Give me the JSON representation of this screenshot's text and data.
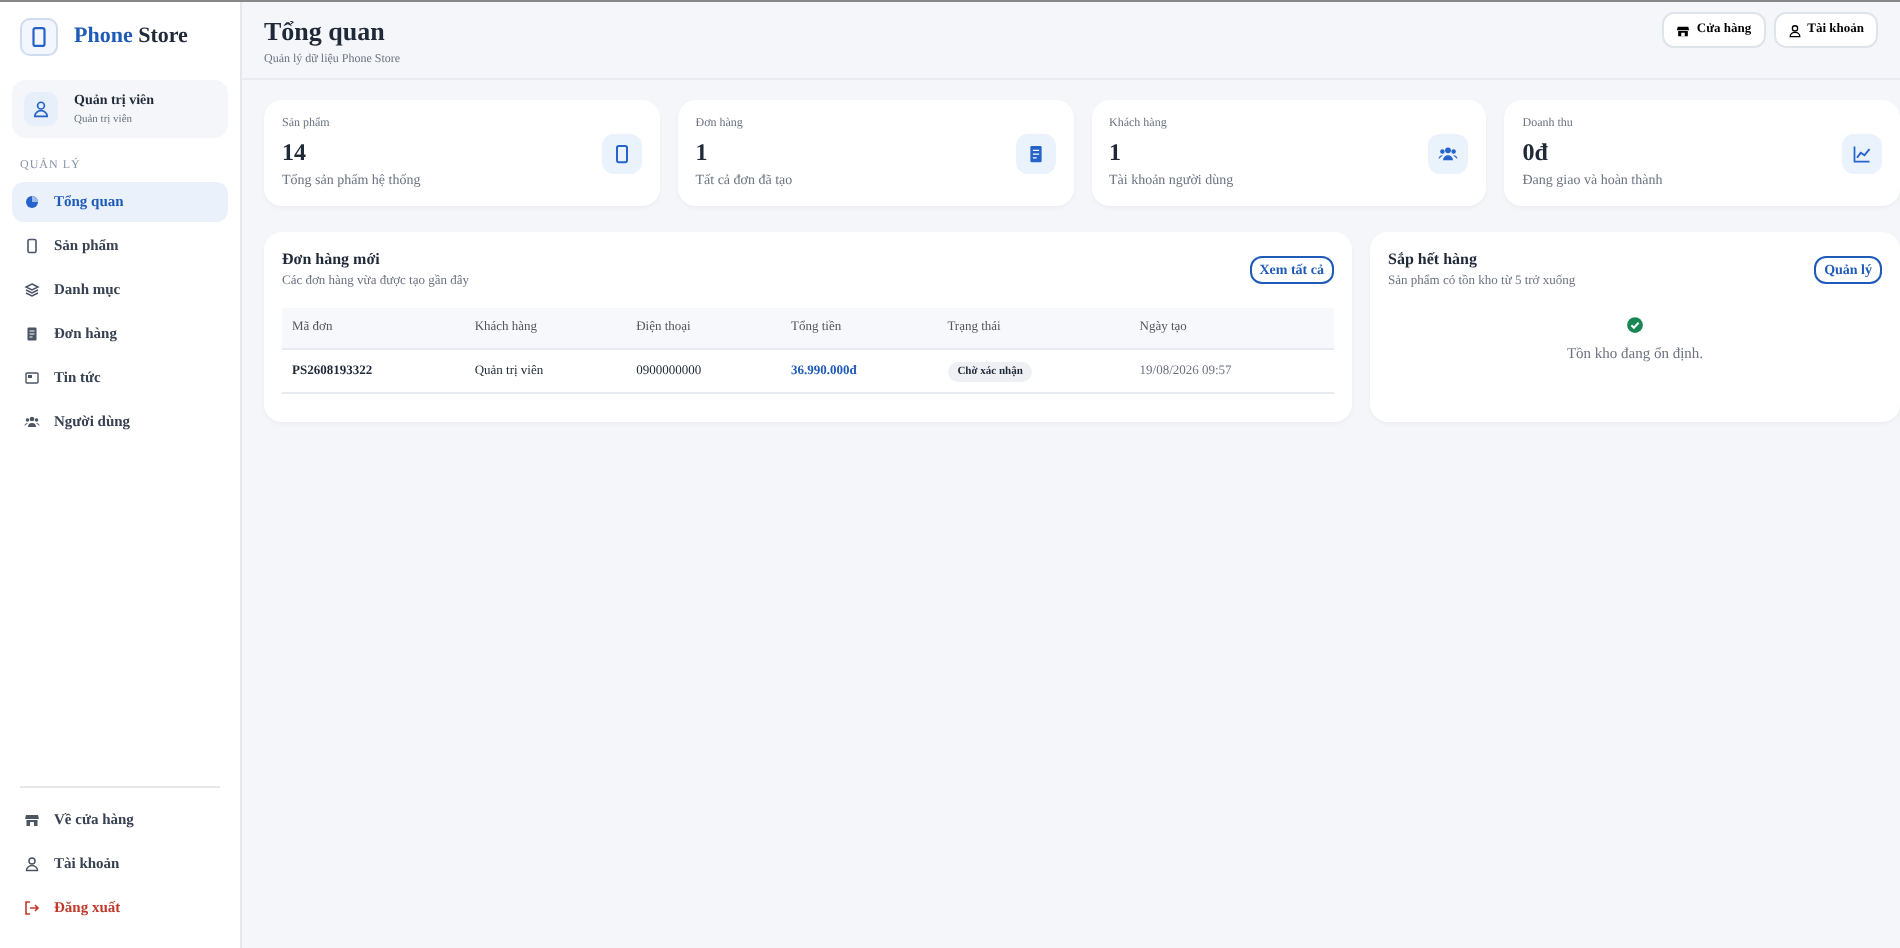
{
  "brand": {
    "first": "Phone",
    "second": "Store"
  },
  "user": {
    "name": "Quản trị viên",
    "role": "Quản trị viên"
  },
  "sidebar": {
    "section": "QUẢN LÝ",
    "items": [
      {
        "label": "Tổng quan",
        "kind": "pie",
        "selected": true
      },
      {
        "label": "Sản phẩm",
        "kind": "phone",
        "selected": false
      },
      {
        "label": "Danh mục",
        "kind": "layers",
        "selected": false
      },
      {
        "label": "Đơn hàng",
        "kind": "receipt",
        "selected": false
      },
      {
        "label": "Tin tức",
        "kind": "news",
        "selected": false
      },
      {
        "label": "Người dùng",
        "kind": "users",
        "selected": false
      }
    ],
    "bottom_items": [
      {
        "label": "Về cửa hàng",
        "kind": "shop"
      },
      {
        "label": "Tài khoản",
        "kind": "user"
      },
      {
        "label": "Đăng xuất",
        "kind": "logout"
      }
    ]
  },
  "header": {
    "title": "Tổng quan",
    "subtitle": "Quản lý dữ liệu Phone Store",
    "buttons": [
      {
        "label": "Cửa hàng",
        "kind": "shop"
      },
      {
        "label": "Tài khoản",
        "kind": "user"
      }
    ]
  },
  "stats": [
    {
      "label": "Sản phẩm",
      "value": "14",
      "note": "Tổng sản phẩm hệ thống",
      "kind": "phone"
    },
    {
      "label": "Đơn hàng",
      "value": "1",
      "note": "Tất cả đơn đã tạo",
      "kind": "receipt"
    },
    {
      "label": "Khách hàng",
      "value": "1",
      "note": "Tài khoản người dùng",
      "kind": "users"
    },
    {
      "label": "Doanh thu",
      "value": "0đ",
      "note": "Đang giao và hoàn thành",
      "kind": "chart"
    }
  ],
  "orders": {
    "title": "Đơn hàng mới",
    "subtitle": "Các đơn hàng vừa được tạo gần đây",
    "button": "Xem tất cả",
    "columns": [
      "Mã đơn",
      "Khách hàng",
      "Điện thoại",
      "Tổng tiền",
      "Trạng thái",
      "Ngày tạo"
    ],
    "rows": [
      {
        "code": "PS2608193322",
        "customer": "Quản trị viên",
        "phone": "0900000000",
        "total": "36.990.000đ",
        "status": "Chờ xác nhận",
        "date": "19/08/2026 09:57"
      }
    ]
  },
  "low_stock": {
    "title": "Sắp hết hàng",
    "subtitle": "Sản phẩm có tồn kho từ 5 trở xuống",
    "button": "Quản lý",
    "empty_message": "Tồn kho đang ổn định."
  }
}
